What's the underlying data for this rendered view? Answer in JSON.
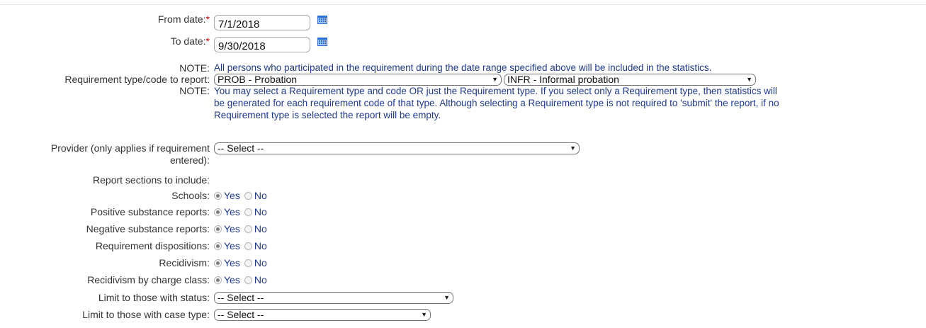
{
  "form": {
    "from_date": {
      "label": "From date:",
      "required_mark": "*",
      "value": "7/1/2018"
    },
    "to_date": {
      "label": "To date:",
      "required_mark": "*",
      "value": "9/30/2018"
    },
    "note1": {
      "label": "NOTE:",
      "text": "All persons who participated in the requirement during the date range specified above will be included in the statistics."
    },
    "requirement": {
      "label": "Requirement type/code to report:",
      "type_value": "PROB - Probation",
      "code_value": "INFR - Informal probation"
    },
    "note2": {
      "label": "NOTE:",
      "lines": [
        "You may select a Requirement type and code OR just the Requirement type.  If you select only a Requirement type, then statistics will",
        "be generated for each requirement code of that type. Although selecting a Requirement type is not required to 'submit' the report, if no",
        "Requirement type is selected the report will be empty."
      ]
    },
    "provider": {
      "label_line1": "Provider (only applies if requirement",
      "label_line2": "entered):",
      "value": "-- Select --"
    },
    "sections_label": "Report sections to include:",
    "sections": [
      {
        "label": "Schools:",
        "selected": "Yes"
      },
      {
        "label": "Positive substance reports:",
        "selected": "Yes"
      },
      {
        "label": "Negative substance reports:",
        "selected": "Yes"
      },
      {
        "label": "Requirement dispositions:",
        "selected": "Yes"
      },
      {
        "label": "Recidivism:",
        "selected": "Yes"
      },
      {
        "label": "Recidivism by charge class:",
        "selected": "Yes"
      }
    ],
    "radio_yes": "Yes",
    "radio_no": "No",
    "status": {
      "label": "Limit to those with status:",
      "value": "-- Select --"
    },
    "case_type": {
      "label": "Limit to those with case type:",
      "value": "-- Select --"
    }
  },
  "icons": {
    "calendar": "calendar-icon",
    "dropdown": "chevron-down-icon"
  },
  "colors": {
    "note_text": "#1f3a8f",
    "required_mark": "#cc0000"
  }
}
